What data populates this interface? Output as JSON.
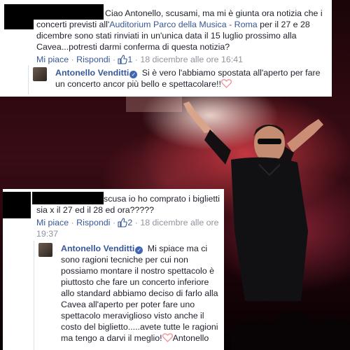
{
  "colors": {
    "link": "#365899",
    "meta": "#90949c",
    "text": "#1d2129",
    "heart": "#f58f97"
  },
  "comment1": {
    "text_before": "Ciao Antonello, scusami, ma mi è giunta ora notizia che i concerti previsti all'",
    "link": "Auditorium Parco della Musica - Roma",
    "text_after": " per il 27 e 28 dicembre sono stati rinviati in un'unica data il 15 luglio prossimo alla Cavea...potresti darmi conferma di questa notizia?",
    "like_label": "Mi piace",
    "reply_label": "Rispondi",
    "likes": "1",
    "timestamp": "18 dicembre alle ore 16:41"
  },
  "reply1": {
    "author": "Antonello Venditti",
    "text": "Si è vero l'abbiamo spostata all'aperto per fare un concerto ancor più bello e spettacolare!!",
    "icons": [
      "verified-badge-icon",
      "heart-icon"
    ]
  },
  "comment2": {
    "text": "scusa io ho comprato i biglietti sia x il 27 ed il 28 ed ora?????",
    "like_label": "Mi piace",
    "reply_label": "Rispondi",
    "likes": "2",
    "timestamp": "18 dicembre alle ore 19:37"
  },
  "reply2": {
    "author": "Antonello Venditti",
    "text": "Mi spiace ma ci sono ragioni tecniche per cui non possiamo montare il nostro spettacolo è piuttosto che fare un concerto inferiore allo standard abbiamo deciso di farlo alla Cavea all'aperto per poter fare uno spettacolo meraviglioso visto anche il costo del biglietto.....avete tutte le ragioni ma tengo a darvi il meglio!",
    "signature": "Antonello"
  }
}
